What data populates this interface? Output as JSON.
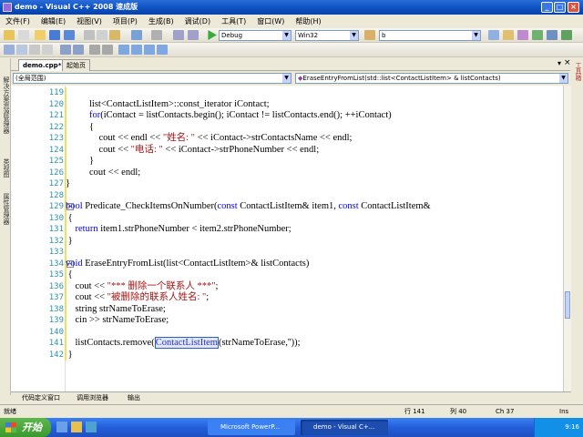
{
  "window": {
    "title": "demo - Visual C++ 2008 速成版"
  },
  "menu": [
    "文件(F)",
    "编辑(E)",
    "视图(V)",
    "项目(P)",
    "生成(B)",
    "调试(D)",
    "工具(T)",
    "窗口(W)",
    "帮助(H)"
  ],
  "toolbar": {
    "config": "Debug",
    "platform": "Win32",
    "find": "b"
  },
  "tabs": [
    {
      "label": "demo.cpp*",
      "active": true
    },
    {
      "label": "起始页",
      "active": false
    }
  ],
  "navbar": {
    "scope": "(全局范围)",
    "member": "EraseEntryFromList(std::list<ContactListItem> & listContacts)"
  },
  "editor": {
    "lines": [
      {
        "n": "119",
        "html": ""
      },
      {
        "n": "120",
        "html": "list&lt;ContactListItem&gt;::const_iterator iContact;"
      },
      {
        "n": "121",
        "html": "<span class=\"kw\">for</span>(iContact = listContacts.begin(); iContact != listContacts.end(); ++iContact)"
      },
      {
        "n": "122",
        "html": "{"
      },
      {
        "n": "123",
        "html": "    cout &lt;&lt; endl &lt;&lt; <span class=\"str\">\"姓名: \"</span> &lt;&lt; iContact-&gt;strContactsName &lt;&lt; endl;"
      },
      {
        "n": "124",
        "html": "    cout &lt;&lt; <span class=\"str\">\"电话: \"</span> &lt;&lt; iContact-&gt;strPhoneNumber &lt;&lt; endl;"
      },
      {
        "n": "125",
        "html": "}"
      },
      {
        "n": "126",
        "html": "cout &lt;&lt; endl;"
      },
      {
        "n": "127",
        "html": "}"
      },
      {
        "n": "128",
        "html": ""
      },
      {
        "n": "129",
        "html": "<span class=\"kw\">bool</span> Predicate_CheckItemsOnNumber(<span class=\"kw\">const</span> ContactListItem&amp; item1, <span class=\"kw\">const</span> ContactListItem&amp;"
      },
      {
        "n": "130",
        "html": " {"
      },
      {
        "n": "131",
        "html": "    <span class=\"kw\">return</span> item1.strPhoneNumber &lt; item2.strPhoneNumber;"
      },
      {
        "n": "132",
        "html": " }"
      },
      {
        "n": "133",
        "html": ""
      },
      {
        "n": "134",
        "html": "<span class=\"kw\">void</span> EraseEntryFromList(list&lt;ContactListItem&gt;&amp; listContacts)"
      },
      {
        "n": "135",
        "html": " {"
      },
      {
        "n": "136",
        "html": "    cout &lt;&lt; <span class=\"str\">\"*** 删除一个联系人 ***\"</span>;"
      },
      {
        "n": "137",
        "html": "    cout &lt;&lt; <span class=\"str\">\"被删除的联系人姓名: \"</span>;"
      },
      {
        "n": "138",
        "html": "    string strNameToErase;"
      },
      {
        "n": "139",
        "html": "    cin &gt;&gt; strNameToErase;"
      },
      {
        "n": "140",
        "html": ""
      },
      {
        "n": "141",
        "html": "    listContacts.remove(<span class=\"hl\">ContactListItem</span>(strNameToErase,''));"
      },
      {
        "n": "142",
        "html": " }"
      }
    ]
  },
  "left_dock": [
    "解决方案资源管理器",
    "类视图",
    "属性管理器"
  ],
  "right_dock": [
    "工具箱"
  ],
  "bottom_tabs": [
    "代码定义窗口",
    "调用浏览器",
    "输出"
  ],
  "status": {
    "ready": "就绪",
    "row": "行 141",
    "col": "列 40",
    "ch": "Ch 37",
    "mode": "Ins"
  },
  "taskbar": {
    "start": "开始",
    "tasks": [
      "Microsoft PowerP...",
      "demo - Visual C+..."
    ],
    "clock": "9:16"
  },
  "colors": {
    "keyword": "#0000ff",
    "string": "#a31515",
    "line_number": "#2b91af"
  }
}
